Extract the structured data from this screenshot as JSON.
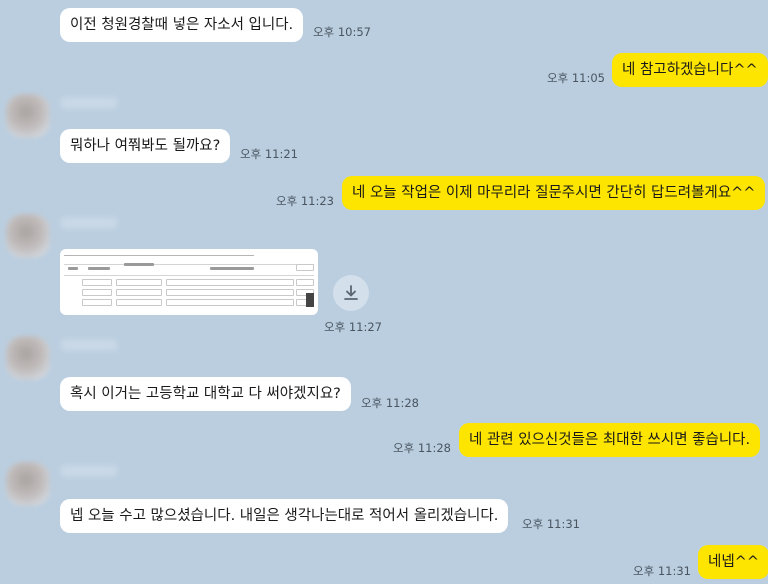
{
  "messages": [
    {
      "text": "이전 청원경찰때 넣은 자소서 입니다.",
      "time": "오후 10:57"
    },
    {
      "text": "네 참고하겠습니다^^",
      "time": "오후 11:05"
    },
    {
      "text": "뭐하나 여쭤봐도 될까요?",
      "time": "오후 11:21"
    },
    {
      "text": "네 오늘 작업은 이제 마무리라 질문주시면 간단히 답드려볼게요^^",
      "time": "오후 11:23"
    },
    {
      "text": "",
      "time": "오후 11:27"
    },
    {
      "text": "혹시 이거는 고등학교 대학교 다 써야겠지요?",
      "time": "오후 11:28"
    },
    {
      "text": "네 관련 있으신것들은 최대한 쓰시면 좋습니다.",
      "time": "오후 11:28"
    },
    {
      "text": "넵 오늘 수고 많으셨습니다. 내일은 생각나는대로 적어서 올리겠습니다.",
      "time": "오후 11:31"
    },
    {
      "text": "네넵^^",
      "time": "오후 11:31"
    }
  ],
  "colors": {
    "background": "#bacee0",
    "incoming_bubble": "#ffffff",
    "outgoing_bubble": "#fee500"
  },
  "icons": {
    "download": "download-icon"
  }
}
